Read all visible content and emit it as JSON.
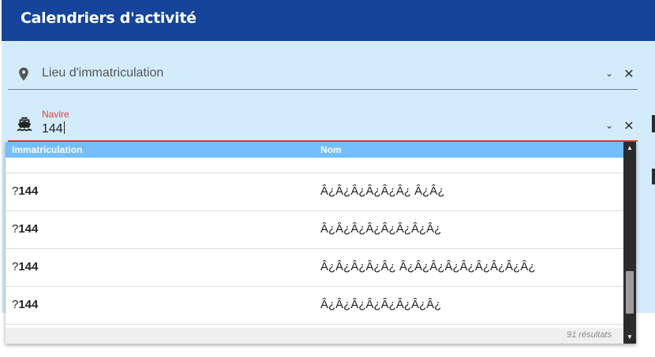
{
  "header": {
    "title": "Calendriers d'activité"
  },
  "fields": {
    "lieu": {
      "placeholder": "Lieu d'immatriculation",
      "icon": "map-pin-icon"
    },
    "navire": {
      "label": "Navire",
      "value": "144",
      "icon": "ship-icon"
    },
    "chevron": "⌄",
    "clear": "✕"
  },
  "dropdown": {
    "columns": {
      "immatriculation": "Immatriculation",
      "nom": "Nom"
    },
    "partial_row": {
      "immat_prefix": "",
      "immat_match": "",
      "nom": ""
    },
    "rows": [
      {
        "immat_prefix": "?",
        "immat_match": "144",
        "nom": "Â¿Â¿Â¿Â¿Â¿Â¿ Â¿Â¿"
      },
      {
        "immat_prefix": "?",
        "immat_match": "144",
        "nom": "Â¿Â¿Â¿Â¿Â¿Â¿Â¿Â¿"
      },
      {
        "immat_prefix": "?",
        "immat_match": "144",
        "nom": "Â¿Â¿Â¿Â¿Â¿ Â¿Â¿Â¿Â¿Â¿Â¿Â¿Â¿Â¿"
      },
      {
        "immat_prefix": "?",
        "immat_match": "144",
        "nom": "Â¿Â¿Â¿Â¿Â¿Â¿Â¿Â¿"
      }
    ],
    "result_count": "91 résultats",
    "scroll_up": "▲",
    "scroll_down": "▼"
  },
  "colors": {
    "header_bg": "#15449a",
    "panel_bg": "#d3ecfb",
    "dropdown_head_bg": "#73befc",
    "active_underline": "#e53935"
  }
}
